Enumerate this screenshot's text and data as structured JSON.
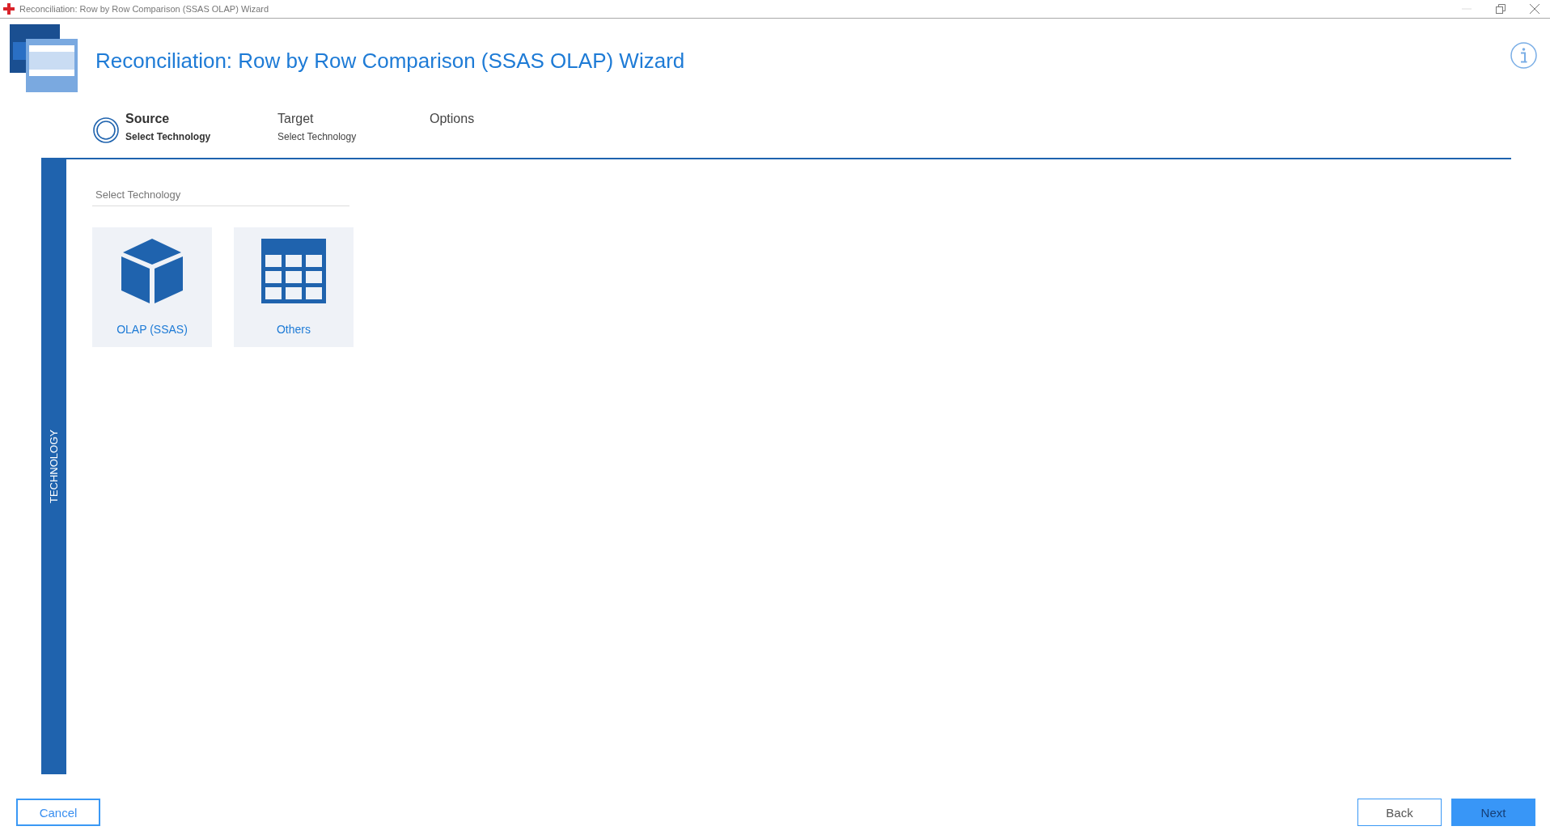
{
  "window": {
    "title": "Reconciliation: Row by Row Comparison (SSAS OLAP) Wizard"
  },
  "header": {
    "title": "Reconciliation: Row by Row Comparison (SSAS OLAP) Wizard"
  },
  "steps": [
    {
      "title": "Source",
      "subtitle": "Select Technology",
      "selected": true
    },
    {
      "title": "Target",
      "subtitle": "Select Technology",
      "selected": false
    },
    {
      "title": "Options",
      "selected": false
    }
  ],
  "sidebar": {
    "label": "TECHNOLOGY"
  },
  "section": {
    "label": "Select Technology"
  },
  "tiles": [
    {
      "label": "OLAP (SSAS)",
      "kind": "cube"
    },
    {
      "label": "Others",
      "kind": "grid"
    }
  ],
  "buttons": [
    {
      "label": "Cancel",
      "kind": "cancel"
    },
    {
      "label": "Back",
      "kind": "secondary"
    },
    {
      "label": "Next",
      "kind": "primary"
    }
  ]
}
